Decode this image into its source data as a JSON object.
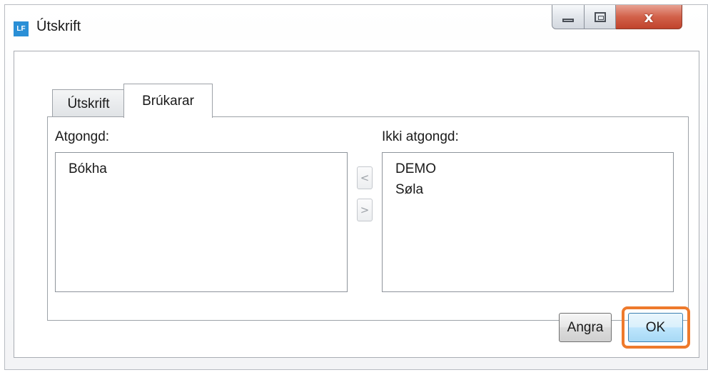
{
  "window": {
    "icon_text": "LF",
    "title": "Útskrift",
    "controls": {
      "minimize": "minimize-icon",
      "maximize": "maximize-icon",
      "close": "close-icon",
      "close_glyph": "x"
    }
  },
  "tabs": [
    {
      "label": "Útskrift",
      "selected": false
    },
    {
      "label": "Brúkarar",
      "selected": true
    }
  ],
  "users": {
    "access_label": "Atgongd:",
    "no_access_label": "Ikki atgongd:",
    "access_items": [
      "Bókha"
    ],
    "no_access_items": [
      "DEMO",
      "Søla"
    ],
    "move_left_glyph": "<",
    "move_right_glyph": ">"
  },
  "buttons": {
    "cancel_label": "Angra",
    "ok_label": "OK"
  },
  "colors": {
    "highlight": "#ee7a2c",
    "close_button": "#c7503a",
    "app_icon": "#2a8fd6"
  }
}
